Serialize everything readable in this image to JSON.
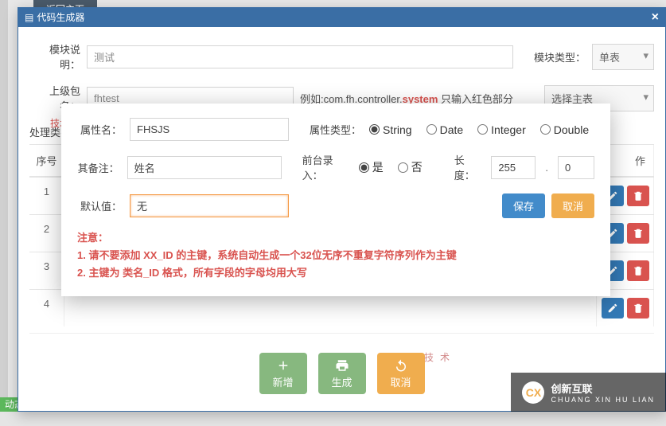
{
  "bg": {
    "tab": "返回主页",
    "bottom": "动态"
  },
  "main_modal": {
    "title": "代码生成器",
    "close": "×",
    "module_desc_label": "模块说明：",
    "module_desc_value": "测试",
    "module_type_label": "模块类型：",
    "module_type_value": "单表",
    "package_label": "上级包名：",
    "package_value": "fhtest",
    "package_hint_prefix": "例如:com.fh.controller.",
    "package_hint_red": "system",
    "package_hint_suffix": " 只输入红色部分",
    "main_table_value": "选择主表",
    "classname_label": "处理类名",
    "watermark": "技术",
    "table": {
      "seq_header": "序号",
      "op_header": "作",
      "rows": [
        1,
        2,
        3,
        4
      ]
    },
    "footer": {
      "add": "新增",
      "gen": "生成",
      "cancel": "取消"
    },
    "small_watermark": "技术"
  },
  "inner_dialog": {
    "attr_name_label": "属性名：",
    "attr_name_value": "FHSJS",
    "attr_type_label": "属性类型：",
    "attr_types": [
      "String",
      "Date",
      "Integer",
      "Double"
    ],
    "attr_type_selected": "String",
    "remark_label": "其备注：",
    "remark_value": "姓名",
    "front_input_label": "前台录入：",
    "front_options": {
      "yes": "是",
      "no": "否"
    },
    "front_selected": "是",
    "length_label": "长度：",
    "length_value": "255",
    "decimal_value": "0",
    "default_label": "默认值：",
    "default_value": "无",
    "save_label": "保存",
    "cancel_label": "取消",
    "notice_title": "注意：",
    "notice_1": "1. 请不要添加 XX_ID 的主键，系统自动生成一个32位无序不重复字符序列作为主键",
    "notice_2": "2. 主键为 类名_ID 格式，所有字段的字母均用大写"
  },
  "logo": {
    "brand": "创新互联",
    "sub": "CHUANG XIN HU LIAN"
  }
}
